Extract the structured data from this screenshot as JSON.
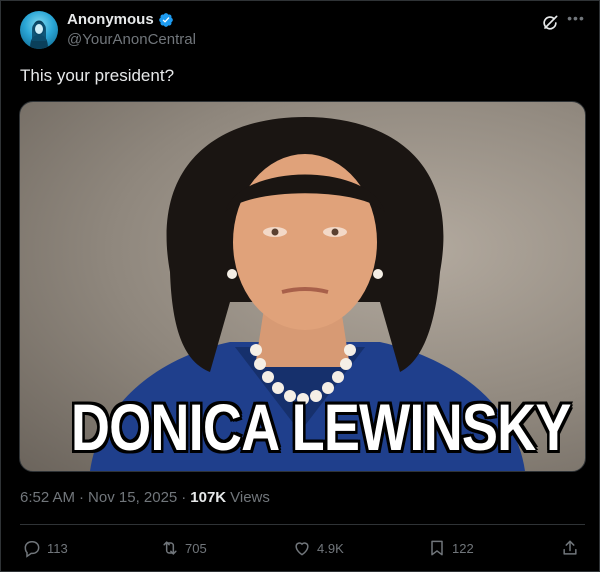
{
  "author": {
    "display_name": "Anonymous",
    "handle": "@YourAnonCentral",
    "verified": true
  },
  "tweet": {
    "text": "This your president?",
    "image_caption": "DONICA LEWINSKY",
    "time": "6:52 AM",
    "date": "Nov 15, 2025",
    "views_count": "107K",
    "views_label": "Views"
  },
  "actions": {
    "replies": "113",
    "reposts": "705",
    "likes": "4.9K",
    "bookmarks": "122"
  },
  "colors": {
    "background": "#000000",
    "text_primary": "#e7e9ea",
    "text_secondary": "#71767b",
    "verified": "#1d9bf0",
    "border": "#2f3336"
  },
  "icons": [
    "verified-badge-icon",
    "grok-icon",
    "more-icon",
    "reply-icon",
    "repost-icon",
    "like-icon",
    "bookmark-icon",
    "share-icon"
  ]
}
